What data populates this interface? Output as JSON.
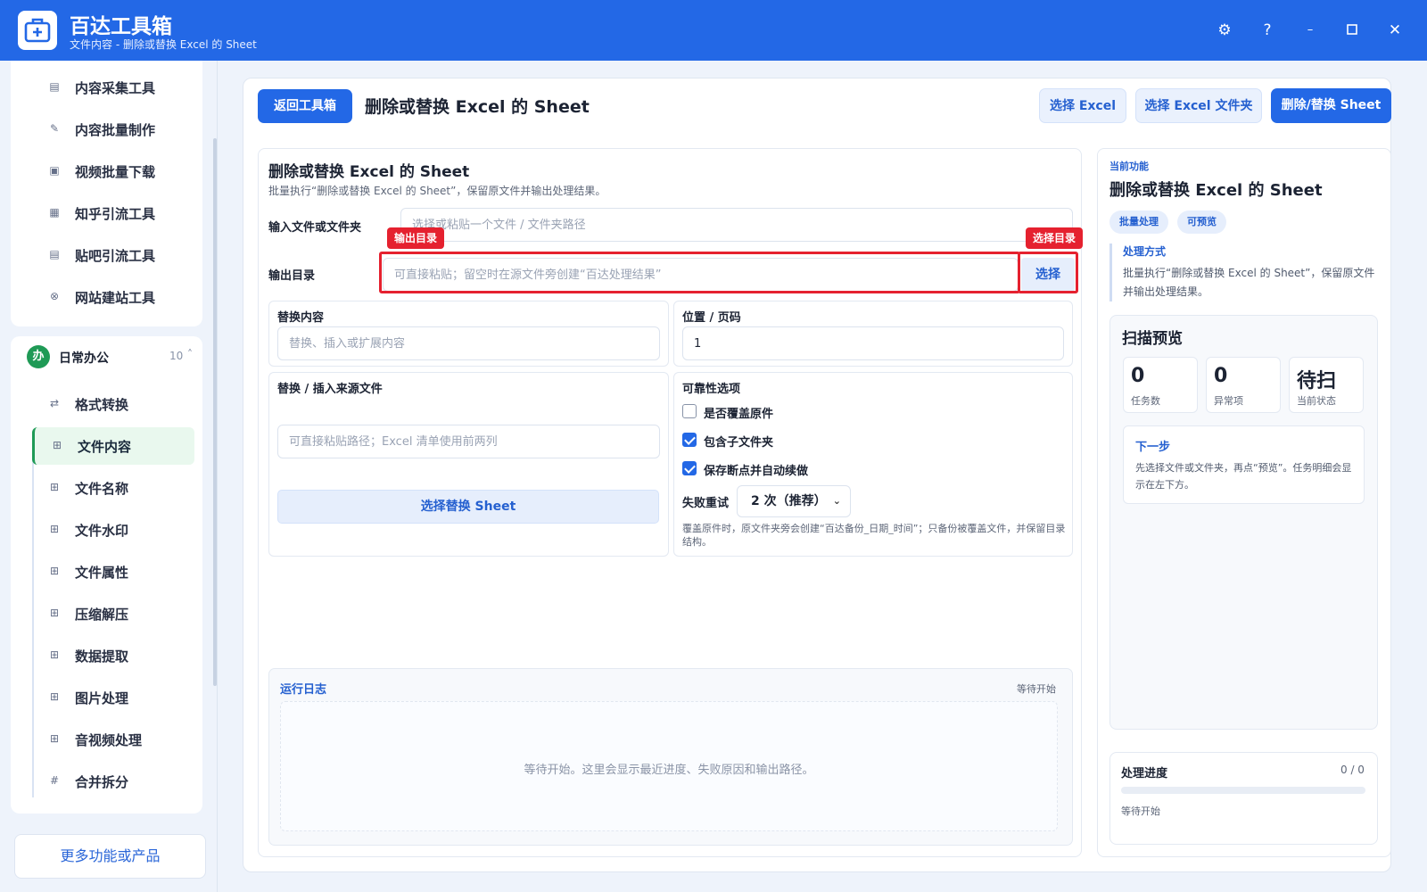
{
  "app": {
    "title": "百达工具箱",
    "subtitle": "文件内容 - 删除或替换 Excel 的 Sheet",
    "accent": "#2368e6"
  },
  "window_controls": [
    "gear-icon",
    "help-icon",
    "minimize-icon",
    "maximize-icon",
    "close-icon"
  ],
  "sidebar": {
    "top_items": [
      {
        "label": "内容采集工具",
        "icon": "collect-icon"
      },
      {
        "label": "内容批量制作",
        "icon": "pen-icon"
      },
      {
        "label": "视频批量下载",
        "icon": "video-download-icon"
      },
      {
        "label": "知乎引流工具",
        "icon": "zhihu-icon"
      },
      {
        "label": "贴吧引流工具",
        "icon": "tieba-icon"
      },
      {
        "label": "网站建站工具",
        "icon": "globe-icon"
      }
    ],
    "group": {
      "badge": "办",
      "label": "日常办公",
      "count": "10",
      "chevron": "˄"
    },
    "group_items": [
      {
        "label": "格式转换",
        "icon": "swap-icon"
      },
      {
        "label": "文件内容",
        "icon": "grid-icon",
        "active": true
      },
      {
        "label": "文件名称",
        "icon": "grid-icon"
      },
      {
        "label": "文件水印",
        "icon": "grid-icon"
      },
      {
        "label": "文件属性",
        "icon": "grid-icon"
      },
      {
        "label": "压缩解压",
        "icon": "grid-icon"
      },
      {
        "label": "数据提取",
        "icon": "grid-icon"
      },
      {
        "label": "图片处理",
        "icon": "grid-icon"
      },
      {
        "label": "音视频处理",
        "icon": "grid-icon"
      },
      {
        "label": "合并拆分",
        "icon": "hash-icon"
      }
    ],
    "more_button": "更多功能或产品"
  },
  "toolbar": {
    "back_label": "返回工具箱",
    "title": "删除或替换 Excel 的 Sheet",
    "select_excel": "选择 Excel",
    "select_folder": "选择 Excel 文件夹",
    "run": "删除/替换 Sheet"
  },
  "form": {
    "title": "删除或替换 Excel 的 Sheet",
    "description": "批量执行“删除或替换 Excel 的 Sheet”，保留原文件并输出处理结果。",
    "input_label": "输入文件或文件夹",
    "input_placeholder": "选择或粘贴一个文件 / 文件夹路径",
    "output_label": "输出目录",
    "output_placeholder": "可直接粘贴；留空时在源文件旁创建“百达处理结果”",
    "output_tag": "输出目录",
    "choose_tag": "选择目录",
    "choose_button": "选择",
    "replace_label": "替换内容",
    "replace_placeholder": "替换、插入或扩展内容",
    "position_label": "位置 / 页码",
    "position_value": "1",
    "source_label": "替换 / 插入来源文件",
    "source_placeholder": "可直接粘贴路径；Excel 清单使用前两列",
    "source_button": "选择替换 Sheet",
    "reliability_label": "可靠性选项",
    "options": [
      {
        "label": "是否覆盖原件",
        "checked": false
      },
      {
        "label": "包含子文件夹",
        "checked": true
      },
      {
        "label": "保存断点并自动续做",
        "checked": true
      }
    ],
    "retry_label": "失败重试",
    "retry_value": "2 次（推荐）",
    "note": "覆盖原件时，原文件夹旁会创建“百达备份_日期_时间”；只备份被覆盖文件，并保留目录结构。"
  },
  "log": {
    "title": "运行日志",
    "status": "等待开始",
    "empty": "等待开始。这里会显示最近进度、失败原因和输出路径。"
  },
  "right_panel": {
    "kicker": "当前功能",
    "title": "删除或替换 Excel 的 Sheet",
    "chips": [
      "批量处理",
      "可预览"
    ],
    "method_title": "处理方式",
    "method_text": "批量执行“删除或替换 Excel 的 Sheet”，保留原文件并输出处理结果。",
    "preview_title": "扫描预览",
    "stats": [
      {
        "value": "0",
        "label": "任务数"
      },
      {
        "value": "0",
        "label": "异常项"
      },
      {
        "value": "待扫",
        "label": "当前状态"
      }
    ],
    "next_title": "下一步",
    "next_text": "先选择文件或文件夹，再点“预览”。任务明细会显示在左下方。",
    "progress_title": "处理进度",
    "progress_count": "0 / 0",
    "progress_fraction": 0,
    "progress_status": "等待开始"
  }
}
